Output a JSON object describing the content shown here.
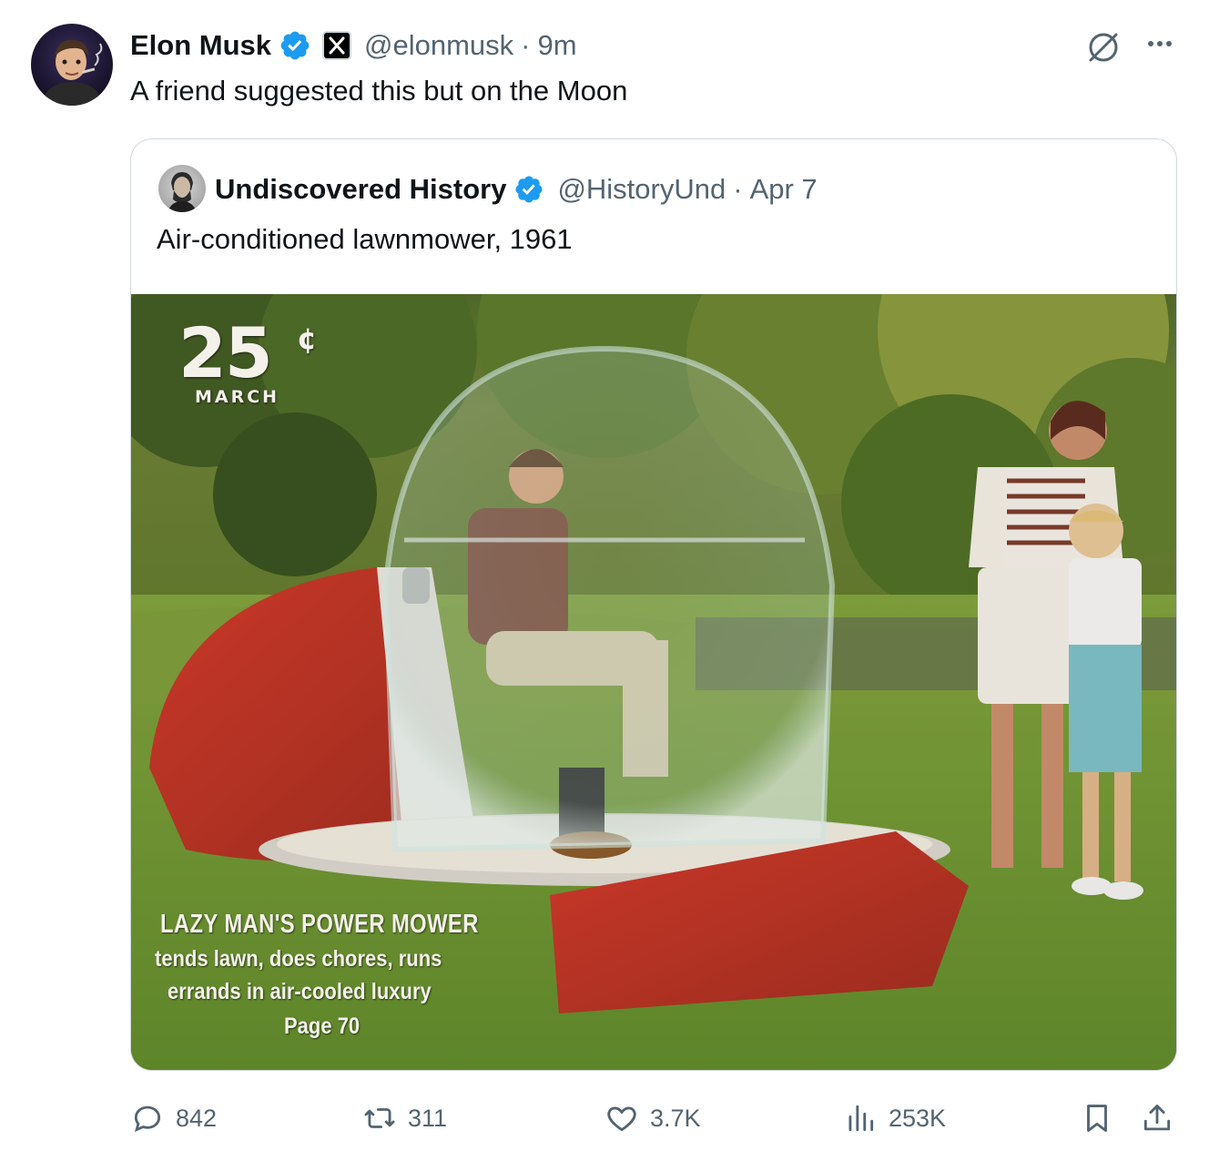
{
  "tweet": {
    "author_name": "Elon Musk",
    "author_handle": "@elonmusk",
    "separator": "·",
    "time": "9m",
    "text": "A friend suggested this but on the Moon"
  },
  "quote": {
    "author_name": "Undiscovered History",
    "author_handle": "@HistoryUnd",
    "separator": "·",
    "time": "Apr 7",
    "text": "Air-conditioned lawnmower, 1961",
    "image_text": {
      "price": "25",
      "cent": "¢",
      "month": "MARCH",
      "caption_title": "LAZY MAN'S POWER MOWER",
      "caption_line1": "tends lawn, does chores, runs",
      "caption_line2": "errands in air-cooled luxury",
      "caption_page": "Page 70"
    }
  },
  "actions": {
    "replies": "842",
    "reposts": "311",
    "likes": "3.7K",
    "views": "253K"
  },
  "icons": {
    "verified": "verified-badge-icon",
    "grok": "grok-icon",
    "more": "more-icon",
    "reply": "reply-icon",
    "repost": "repost-icon",
    "like": "heart-icon",
    "views": "views-icon",
    "bookmark": "bookmark-icon",
    "share": "share-icon"
  },
  "colors": {
    "text": "#0f1419",
    "secondary": "#536471",
    "verified_blue": "#1d9bf0",
    "border": "#cfd9de"
  }
}
